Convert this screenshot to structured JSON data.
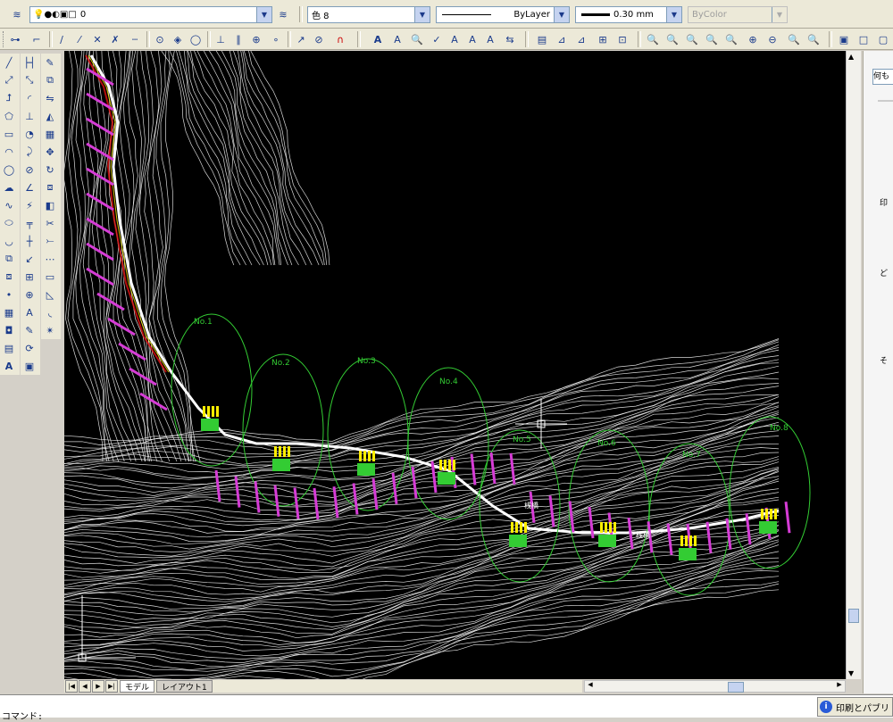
{
  "toolbar": {
    "layer_value": "0",
    "color_value": "色 8",
    "linetype_value": "ByLayer",
    "lineweight_value": "0.30 mm",
    "plotstyle_value": "ByColor"
  },
  "tabs": {
    "model": "モデル",
    "layout1": "レイアウト1"
  },
  "drawing": {
    "stations": [
      "No.1",
      "No.2",
      "No.3",
      "No.4",
      "No.5",
      "No.6",
      "No.7",
      "No.8"
    ],
    "annotations": [
      "桟橋",
      "桟橋"
    ]
  },
  "right_panel": {
    "search_placeholder": "何も",
    "labels": [
      "印",
      "ど",
      "そ"
    ]
  },
  "command": {
    "prompt": "コマンド:"
  },
  "status": {
    "print_button": "印刷とパブリ"
  },
  "colors": {
    "canvas": "#000000",
    "contour": "#ffffff",
    "circle": "#33cc33",
    "magenta": "#d63cd6",
    "yellow": "#ffee00",
    "red": "#e01010"
  }
}
